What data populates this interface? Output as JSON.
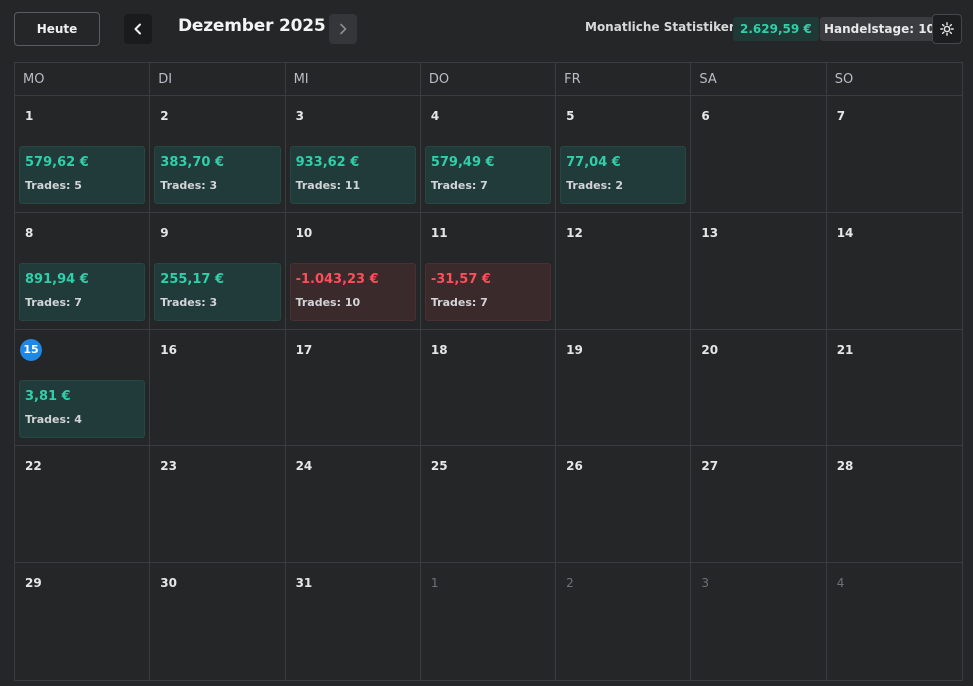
{
  "toolbar": {
    "today_label": "Heute",
    "month_title": "Dezember 2025",
    "stats_label": "Monatliche Statistiken:",
    "stats_value": "2.629,59 €",
    "trading_days": "Handelstage: 10",
    "icons": {
      "prev": "chevron-left-icon",
      "next": "chevron-right-icon",
      "settings": "gear-icon"
    }
  },
  "colors": {
    "profit": "#2fd0a9",
    "loss": "#ff4d5a",
    "today": "#1e88e5",
    "background": "#252628"
  },
  "weekdays": [
    "MO",
    "DI",
    "MI",
    "DO",
    "FR",
    "SA",
    "SO"
  ],
  "weeks": [
    [
      {
        "day": "1",
        "pnl": "579,62 €",
        "trades": "Trades: 5",
        "type": "pos"
      },
      {
        "day": "2",
        "pnl": "383,70 €",
        "trades": "Trades: 3",
        "type": "pos"
      },
      {
        "day": "3",
        "pnl": "933,62 €",
        "trades": "Trades: 11",
        "type": "pos"
      },
      {
        "day": "4",
        "pnl": "579,49 €",
        "trades": "Trades: 7",
        "type": "pos"
      },
      {
        "day": "5",
        "pnl": "77,04 €",
        "trades": "Trades: 2",
        "type": "pos"
      },
      {
        "day": "6"
      },
      {
        "day": "7"
      }
    ],
    [
      {
        "day": "8",
        "pnl": "891,94 €",
        "trades": "Trades: 7",
        "type": "pos"
      },
      {
        "day": "9",
        "pnl": "255,17 €",
        "trades": "Trades: 3",
        "type": "pos"
      },
      {
        "day": "10",
        "pnl": "-1.043,23 €",
        "trades": "Trades: 10",
        "type": "neg"
      },
      {
        "day": "11",
        "pnl": "-31,57 €",
        "trades": "Trades: 7",
        "type": "neg"
      },
      {
        "day": "12"
      },
      {
        "day": "13"
      },
      {
        "day": "14"
      }
    ],
    [
      {
        "day": "15",
        "pnl": "3,81 €",
        "trades": "Trades: 4",
        "type": "pos",
        "today": true
      },
      {
        "day": "16"
      },
      {
        "day": "17"
      },
      {
        "day": "18"
      },
      {
        "day": "19"
      },
      {
        "day": "20"
      },
      {
        "day": "21"
      }
    ],
    [
      {
        "day": "22"
      },
      {
        "day": "23"
      },
      {
        "day": "24"
      },
      {
        "day": "25"
      },
      {
        "day": "26"
      },
      {
        "day": "27"
      },
      {
        "day": "28"
      }
    ],
    [
      {
        "day": "29"
      },
      {
        "day": "30"
      },
      {
        "day": "31"
      },
      {
        "day": "1",
        "other": true
      },
      {
        "day": "2",
        "other": true
      },
      {
        "day": "3",
        "other": true
      },
      {
        "day": "4",
        "other": true
      }
    ]
  ]
}
